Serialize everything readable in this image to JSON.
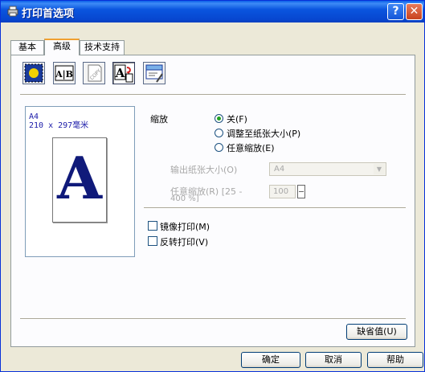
{
  "window": {
    "title": "打印首选项",
    "help_glyph": "?",
    "close_glyph": "✕"
  },
  "tabs": [
    "基本",
    "高级",
    "技术支持"
  ],
  "toolbar": {
    "icons": [
      "print-quality-icon",
      "duplex-icon",
      "copy-icon",
      "scaling-icon",
      "other-options-icon"
    ],
    "duplex_text": "A|B",
    "scaling_text": "A"
  },
  "preview": {
    "size_line1": "A4",
    "size_line2": "210 x 297毫米",
    "paper_letter": "A"
  },
  "scaling": {
    "label": "缩放",
    "options": [
      "关(F)",
      "调整至纸张大小(P)",
      "任意缩放(E)"
    ],
    "selected": "关(F)",
    "output_paper_label": "输出纸张大小(O)",
    "output_paper_value": "A4",
    "free_scale_label_1": "任意缩放(R) [25 -",
    "free_scale_label_2": "400 %]",
    "free_scale_value": "100"
  },
  "options": {
    "mirror_label": "镜像打印(M)",
    "reverse_label": "反转打印(V)"
  },
  "buttons": {
    "default": "缺省值(U)",
    "ok": "确定",
    "cancel": "取消",
    "help": "帮助"
  }
}
